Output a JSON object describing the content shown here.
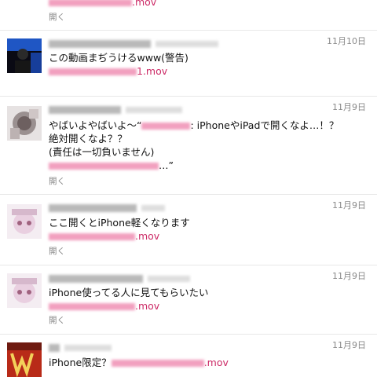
{
  "timeline": {
    "top_fragment": {
      "link_suffix": ".mov",
      "open_label": "開く"
    },
    "tweets": [
      {
        "date": "11月10日",
        "lines": [
          "この動画まぢうけるwww(警告)"
        ],
        "link_suffix": "1.mov",
        "open_label": "開く",
        "avatar_icon": "dark-figure-avatar",
        "accent": "#1f56c4"
      },
      {
        "date": "11月9日",
        "line1_prefix": "やばいよやばいよ～“",
        "line1_suffix": ": iPhoneやiPadで開くなよ…！？",
        "line2": "絶対開くなよ？？",
        "line3": "(責任は一切負いません)",
        "line4_suffix": "…”",
        "open_label": "開く",
        "avatar_icon": "gray-character-avatar"
      },
      {
        "date": "11月9日",
        "lines": [
          "ここ開くとiPhone軽くなります"
        ],
        "link_suffix": ".mov",
        "open_label": "開く",
        "avatar_icon": "anime-girl-avatar"
      },
      {
        "date": "11月9日",
        "lines": [
          "iPhone使ってる人に見てもらいたい"
        ],
        "link_suffix": ".mov",
        "open_label": "開く",
        "avatar_icon": "anime-girl-avatar"
      },
      {
        "date": "11月9日",
        "text_prefix": "iPhone限定？",
        "link_suffix": ".mov",
        "avatar_icon": "red-w-avatar",
        "accent": "#d32d14"
      }
    ]
  }
}
